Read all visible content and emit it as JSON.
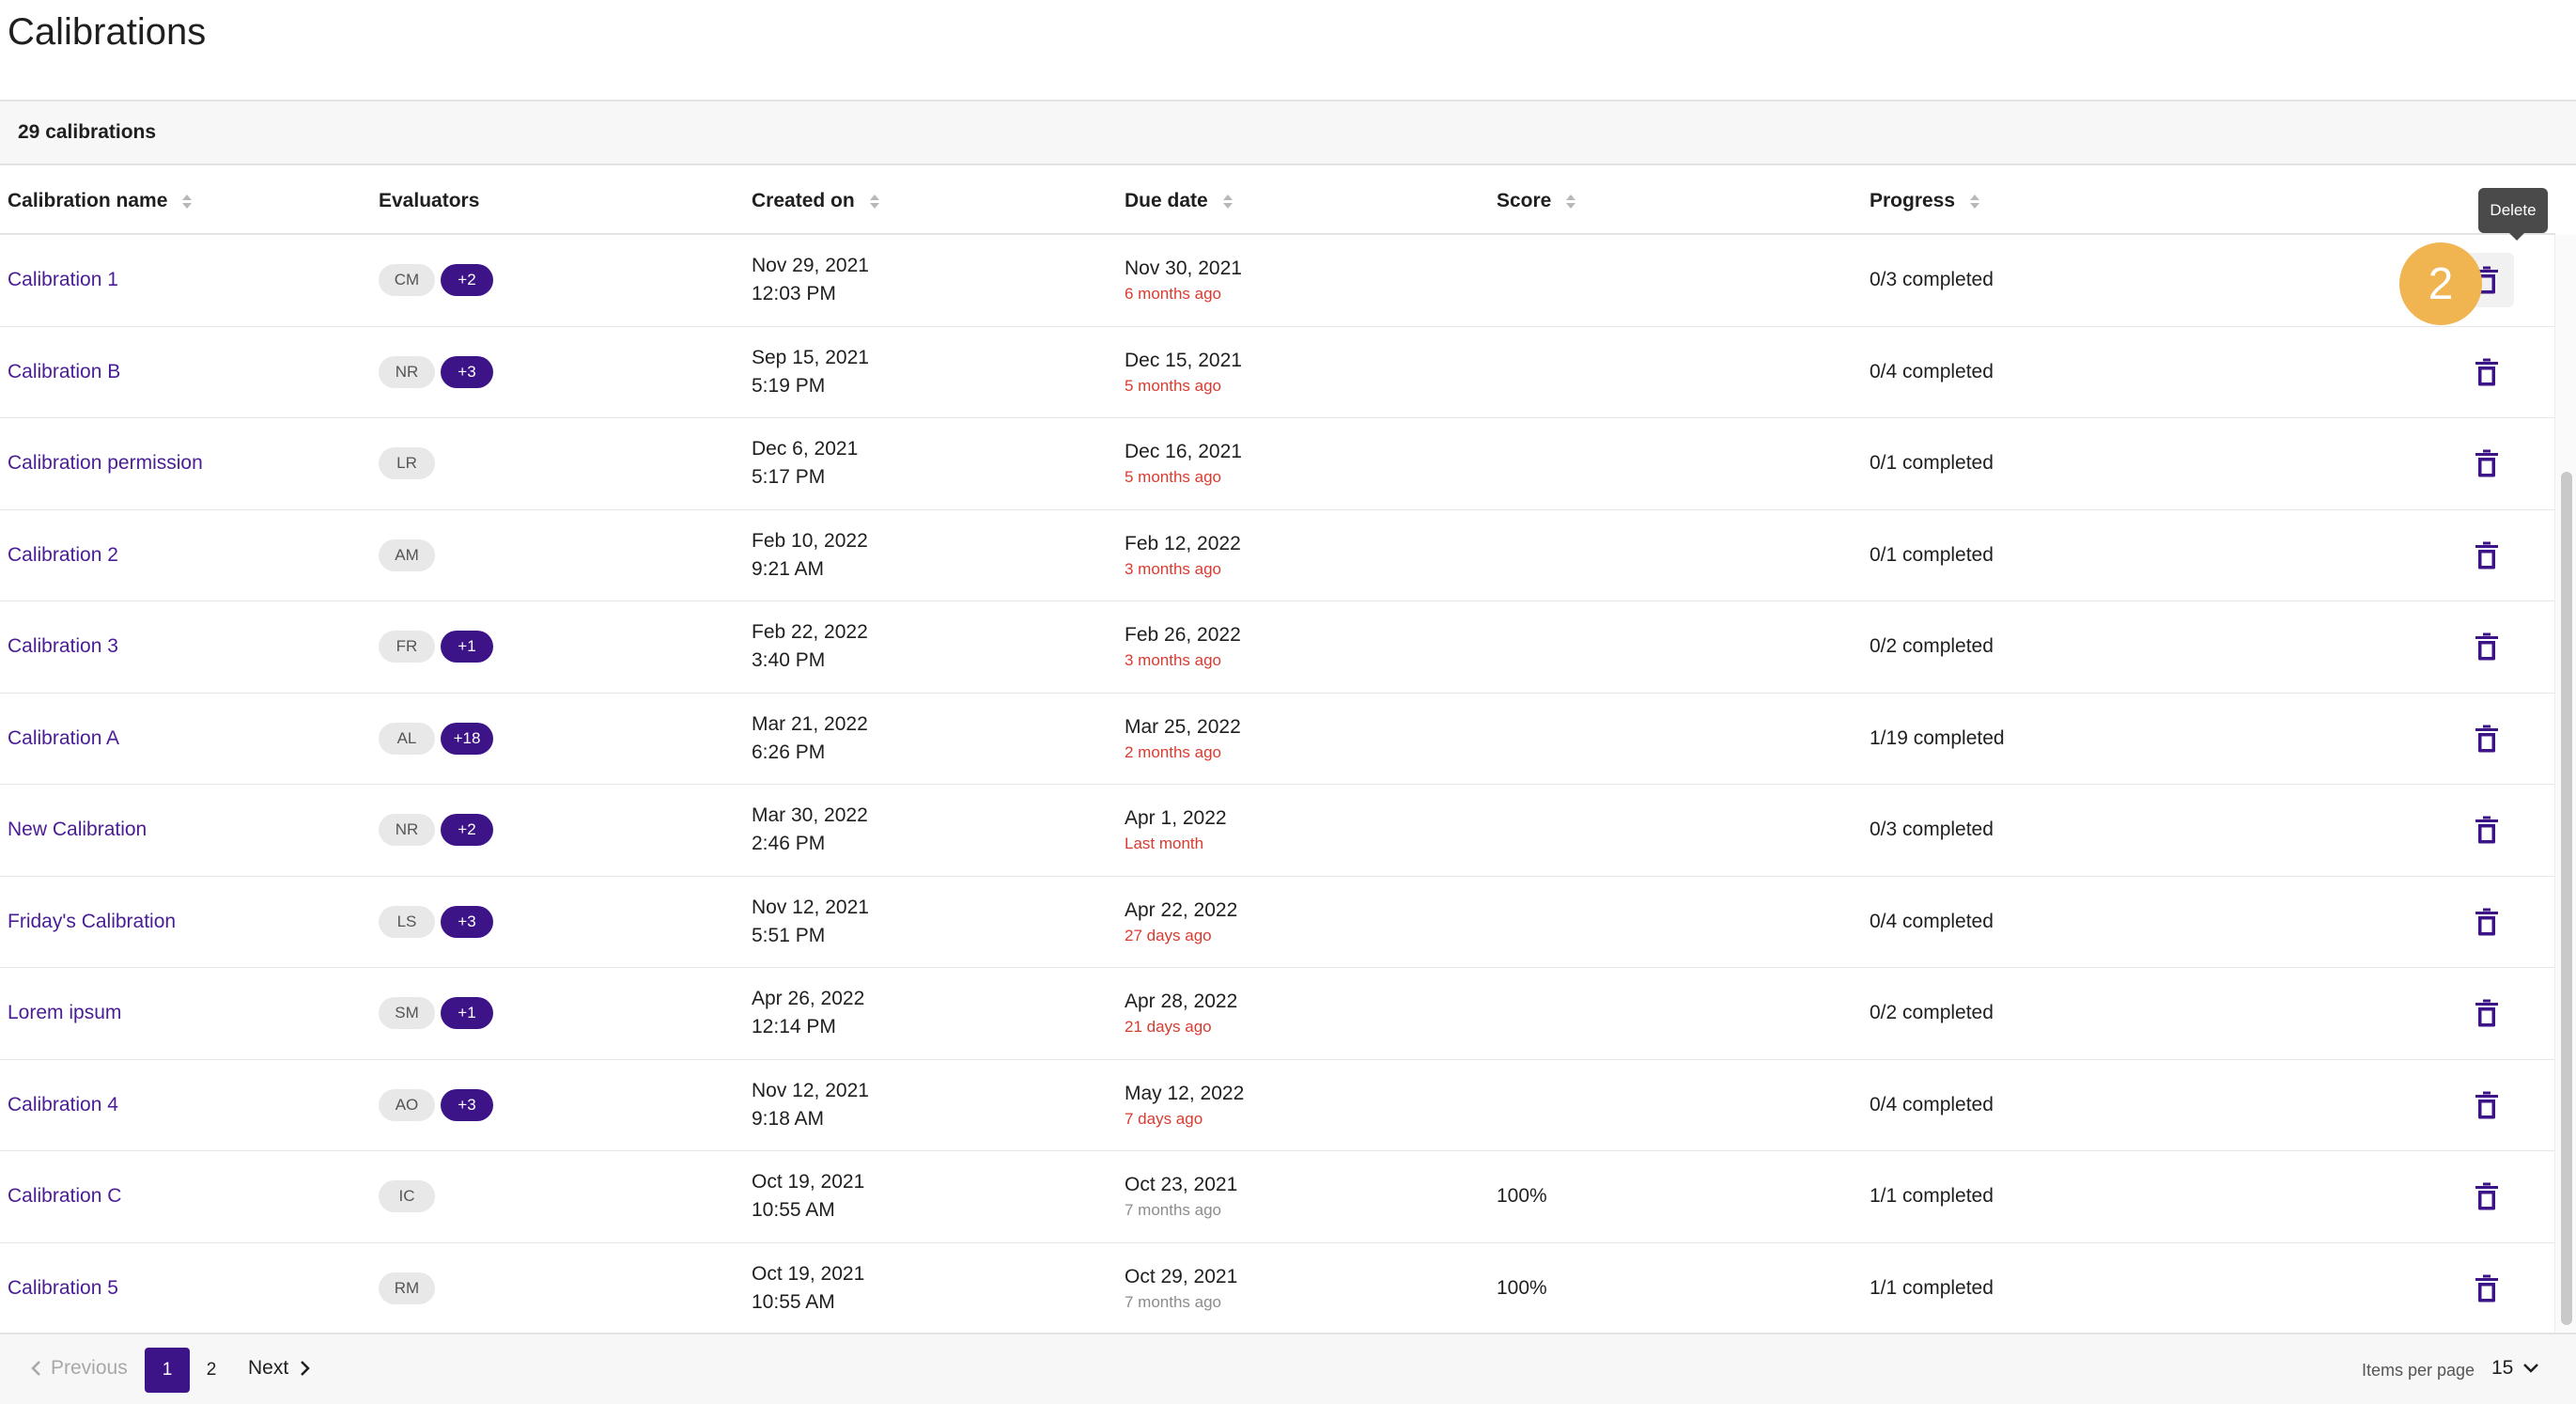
{
  "page": {
    "title": "Calibrations",
    "count_label": "29 calibrations"
  },
  "columns": {
    "name": "Calibration name",
    "evaluators": "Evaluators",
    "created": "Created on",
    "due": "Due date",
    "score": "Score",
    "progress": "Progress"
  },
  "rows": [
    {
      "name": "Calibration 1",
      "evaluator": "CM",
      "more": "+2",
      "created_date": "Nov 29, 2021",
      "created_time": "12:03 PM",
      "due_date": "Nov 30, 2021",
      "due_rel": "6 months ago",
      "due_rel_color": "red",
      "score": "",
      "progress": "0/3 completed"
    },
    {
      "name": "Calibration B",
      "evaluator": "NR",
      "more": "+3",
      "created_date": "Sep 15, 2021",
      "created_time": "5:19 PM",
      "due_date": "Dec 15, 2021",
      "due_rel": "5 months ago",
      "due_rel_color": "red",
      "score": "",
      "progress": "0/4 completed"
    },
    {
      "name": "Calibration permission",
      "evaluator": "LR",
      "more": "",
      "created_date": "Dec 6, 2021",
      "created_time": "5:17 PM",
      "due_date": "Dec 16, 2021",
      "due_rel": "5 months ago",
      "due_rel_color": "red",
      "score": "",
      "progress": "0/1 completed"
    },
    {
      "name": "Calibration 2",
      "evaluator": "AM",
      "more": "",
      "created_date": "Feb 10, 2022",
      "created_time": "9:21 AM",
      "due_date": "Feb 12, 2022",
      "due_rel": "3 months ago",
      "due_rel_color": "red",
      "score": "",
      "progress": "0/1 completed"
    },
    {
      "name": "Calibration 3",
      "evaluator": "FR",
      "more": "+1",
      "created_date": "Feb 22, 2022",
      "created_time": "3:40 PM",
      "due_date": "Feb 26, 2022",
      "due_rel": "3 months ago",
      "due_rel_color": "red",
      "score": "",
      "progress": "0/2 completed"
    },
    {
      "name": "Calibration A",
      "evaluator": "AL",
      "more": "+18",
      "created_date": "Mar 21, 2022",
      "created_time": "6:26 PM",
      "due_date": "Mar 25, 2022",
      "due_rel": "2 months ago",
      "due_rel_color": "red",
      "score": "",
      "progress": "1/19 completed"
    },
    {
      "name": "New Calibration",
      "evaluator": "NR",
      "more": "+2",
      "created_date": "Mar 30, 2022",
      "created_time": "2:46 PM",
      "due_date": "Apr 1, 2022",
      "due_rel": "Last month",
      "due_rel_color": "red",
      "score": "",
      "progress": "0/3 completed"
    },
    {
      "name": "Friday's Calibration",
      "evaluator": "LS",
      "more": "+3",
      "created_date": "Nov 12, 2021",
      "created_time": "5:51 PM",
      "due_date": "Apr 22, 2022",
      "due_rel": "27 days ago",
      "due_rel_color": "red",
      "score": "",
      "progress": "0/4 completed"
    },
    {
      "name": "Lorem ipsum",
      "evaluator": "SM",
      "more": "+1",
      "created_date": "Apr 26, 2022",
      "created_time": "12:14 PM",
      "due_date": "Apr 28, 2022",
      "due_rel": "21 days ago",
      "due_rel_color": "red",
      "score": "",
      "progress": "0/2 completed"
    },
    {
      "name": "Calibration 4",
      "evaluator": "AO",
      "more": "+3",
      "created_date": "Nov 12, 2021",
      "created_time": "9:18 AM",
      "due_date": "May 12, 2022",
      "due_rel": "7 days ago",
      "due_rel_color": "red",
      "score": "",
      "progress": "0/4 completed"
    },
    {
      "name": "Calibration C",
      "evaluator": "IC",
      "more": "",
      "created_date": "Oct 19, 2021",
      "created_time": "10:55 AM",
      "due_date": "Oct 23, 2021",
      "due_rel": "7 months ago",
      "due_rel_color": "grey",
      "score": "100%",
      "progress": "1/1 completed"
    },
    {
      "name": "Calibration 5",
      "evaluator": "RM",
      "more": "",
      "created_date": "Oct 19, 2021",
      "created_time": "10:55 AM",
      "due_date": "Oct 29, 2021",
      "due_rel": "7 months ago",
      "due_rel_color": "grey",
      "score": "100%",
      "progress": "1/1 completed"
    }
  ],
  "row_action": {
    "icon": "trash-icon"
  },
  "tooltip": {
    "text": "Delete"
  },
  "step_badge": {
    "number": "2"
  },
  "pagination": {
    "previous": "Previous",
    "pages": [
      "1",
      "2"
    ],
    "active_page": "1",
    "next": "Next"
  },
  "items_per_page": {
    "label": "Items per page",
    "value": "15"
  },
  "colors": {
    "accent": "#3d1488",
    "link": "#4a1c96",
    "overdue": "#d93b30",
    "badge": "#f0b450"
  }
}
